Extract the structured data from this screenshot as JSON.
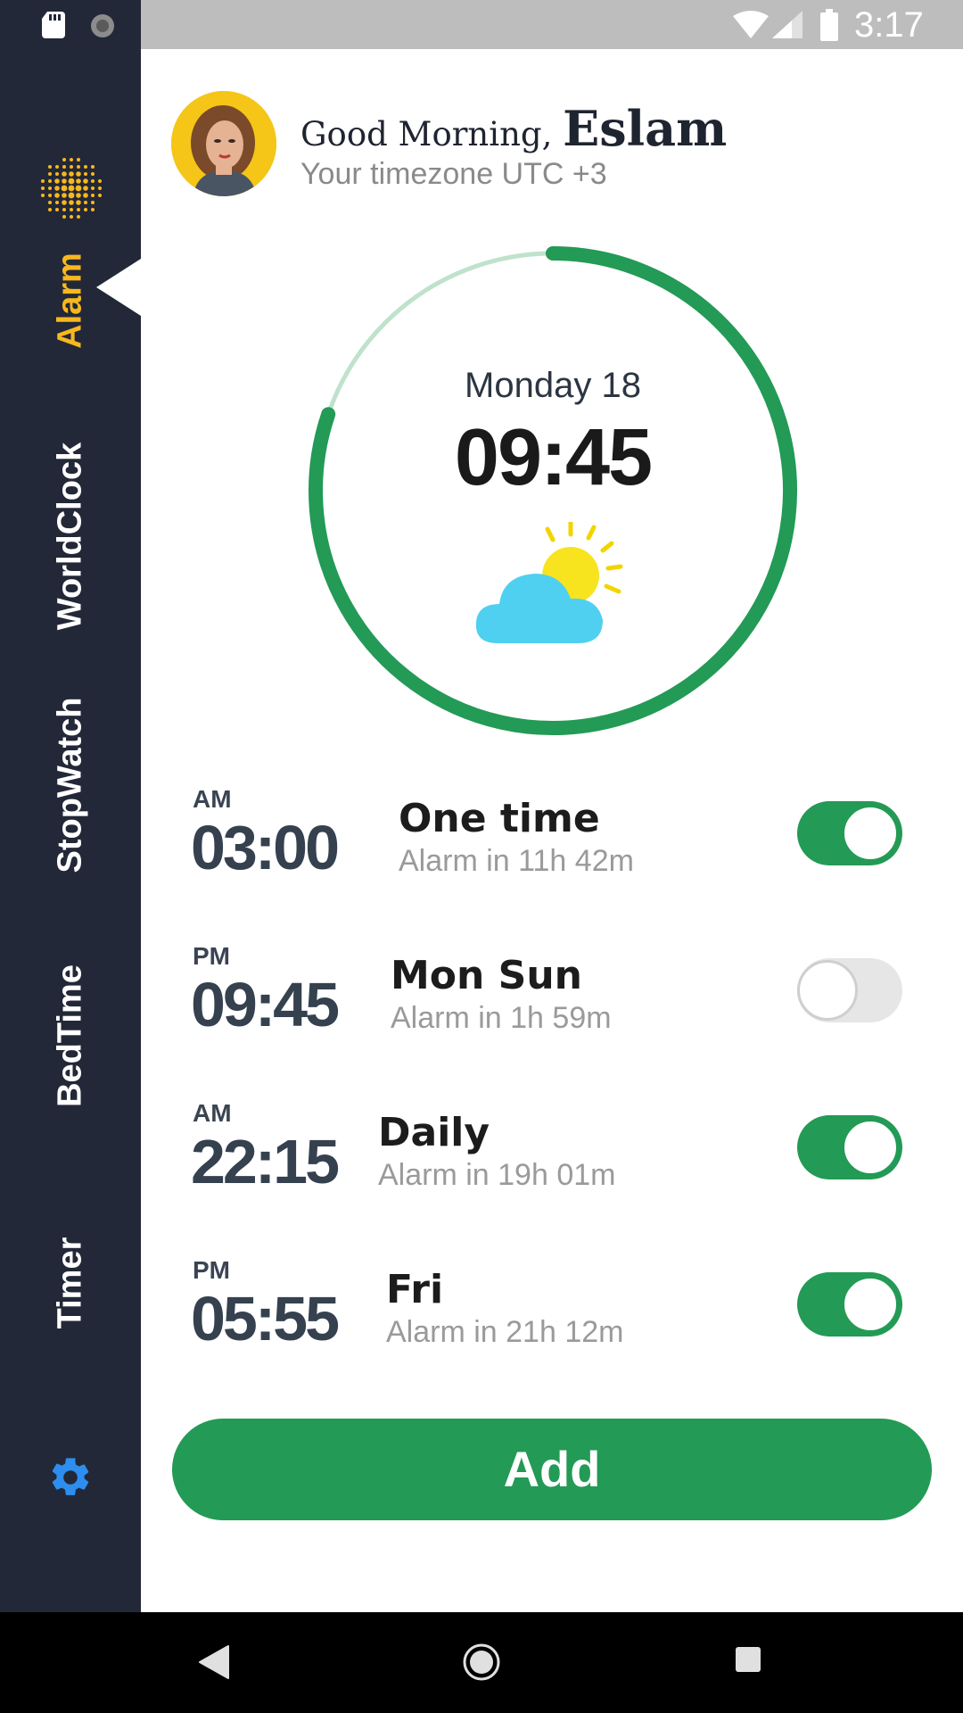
{
  "status_bar": {
    "time": "3:17",
    "icons": [
      "sd-card-icon",
      "sync-icon",
      "wifi-icon",
      "signal-icon",
      "battery-icon"
    ]
  },
  "sidebar": {
    "logo": "dotted-sun-logo-icon",
    "items": [
      {
        "label": "Alarm",
        "active": true
      },
      {
        "label": "WorldClock",
        "active": false
      },
      {
        "label": "StopWatch",
        "active": false
      },
      {
        "label": "BedTime",
        "active": false
      },
      {
        "label": "Timer",
        "active": false
      }
    ],
    "settings_icon": "gear-icon"
  },
  "header": {
    "greeting": "Good Morning,",
    "name": "Eslam",
    "timezone": "Your timezone UTC +3"
  },
  "clock": {
    "day": "Monday 18",
    "time": "09:45",
    "weather_icon": "partly-sunny-icon"
  },
  "alarms": [
    {
      "period": "AM",
      "time": "03:00",
      "repeat": "One time",
      "countdown": "Alarm in 11h 42m",
      "enabled": true
    },
    {
      "period": "PM",
      "time": "09:45",
      "repeat": "Mon Sun",
      "countdown": "Alarm in 1h 59m",
      "enabled": false
    },
    {
      "period": "AM",
      "time": "22:15",
      "repeat": "Daily",
      "countdown": "Alarm in 19h 01m",
      "enabled": true
    },
    {
      "period": "PM",
      "time": "05:55",
      "repeat": "Fri",
      "countdown": "Alarm in 21h 12m",
      "enabled": true
    }
  ],
  "add_button": {
    "label": "Add"
  },
  "colors": {
    "sidebar_bg": "#232838",
    "accent_green": "#239a55",
    "active_nav": "#f7b81e",
    "settings_blue": "#2d8ef0"
  }
}
